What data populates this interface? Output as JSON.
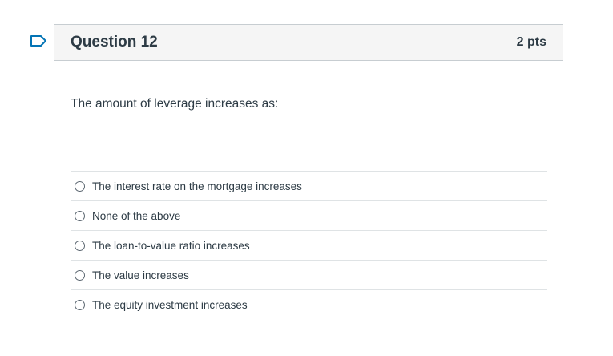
{
  "question": {
    "title": "Question 12",
    "points": "2 pts",
    "prompt": "The amount of leverage increases as:",
    "flag_icon": "flag-outline-icon",
    "accent_color": "#0374b5",
    "answers": [
      {
        "label": "The interest rate on the mortgage increases",
        "selected": false
      },
      {
        "label": "None of the above",
        "selected": false
      },
      {
        "label": "The loan-to-value ratio increases",
        "selected": false
      },
      {
        "label": "The value increases",
        "selected": false
      },
      {
        "label": "The equity investment increases",
        "selected": false
      }
    ]
  }
}
